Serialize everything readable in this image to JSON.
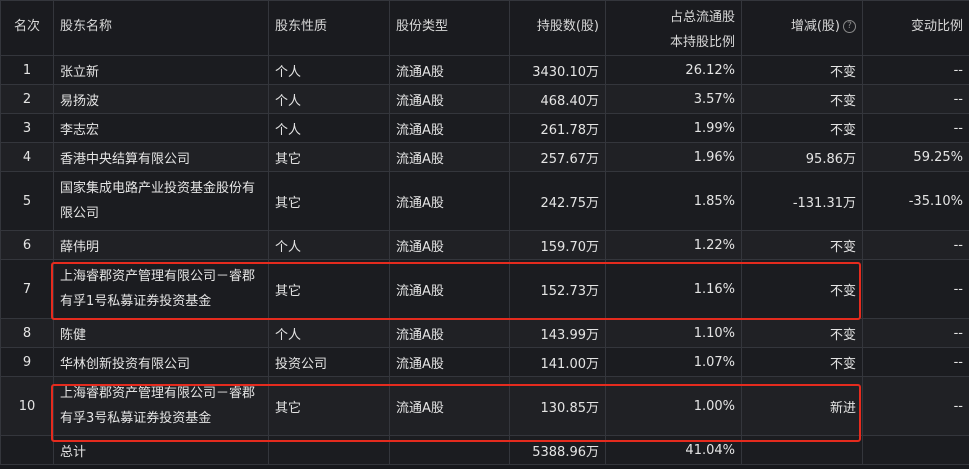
{
  "headers": {
    "rank": "名次",
    "name": "股东名称",
    "nature": "股东性质",
    "share_type": "股份类型",
    "shares": "持股数(股)",
    "ratio_line1": "占总流通股",
    "ratio_line2": "本持股比例",
    "change": "增减(股)",
    "change_help_icon": "?",
    "change_ratio": "变动比例"
  },
  "rows": [
    {
      "rank": "1",
      "name": "张立新",
      "nature": "个人",
      "type": "流通A股",
      "shares": "3430.10万",
      "ratio": "26.12%",
      "change": "不变",
      "change_ratio": "--"
    },
    {
      "rank": "2",
      "name": "易扬波",
      "nature": "个人",
      "type": "流通A股",
      "shares": "468.40万",
      "ratio": "3.57%",
      "change": "不变",
      "change_ratio": "--"
    },
    {
      "rank": "3",
      "name": "李志宏",
      "nature": "个人",
      "type": "流通A股",
      "shares": "261.78万",
      "ratio": "1.99%",
      "change": "不变",
      "change_ratio": "--"
    },
    {
      "rank": "4",
      "name": "香港中央结算有限公司",
      "nature": "其它",
      "type": "流通A股",
      "shares": "257.67万",
      "ratio": "1.96%",
      "change": "95.86万",
      "change_ratio": "59.25%"
    },
    {
      "rank": "5",
      "name": "国家集成电路产业投资基金股份有限公司",
      "nature": "其它",
      "type": "流通A股",
      "shares": "242.75万",
      "ratio": "1.85%",
      "change": "-131.31万",
      "change_ratio": "-35.10%"
    },
    {
      "rank": "6",
      "name": "薛伟明",
      "nature": "个人",
      "type": "流通A股",
      "shares": "159.70万",
      "ratio": "1.22%",
      "change": "不变",
      "change_ratio": "--"
    },
    {
      "rank": "7",
      "name": "上海睿郡资产管理有限公司－睿郡有孚1号私募证券投资基金",
      "nature": "其它",
      "type": "流通A股",
      "shares": "152.73万",
      "ratio": "1.16%",
      "change": "不变",
      "change_ratio": "--"
    },
    {
      "rank": "8",
      "name": "陈健",
      "nature": "个人",
      "type": "流通A股",
      "shares": "143.99万",
      "ratio": "1.10%",
      "change": "不变",
      "change_ratio": "--"
    },
    {
      "rank": "9",
      "name": "华林创新投资有限公司",
      "nature": "投资公司",
      "type": "流通A股",
      "shares": "141.00万",
      "ratio": "1.07%",
      "change": "不变",
      "change_ratio": "--"
    },
    {
      "rank": "10",
      "name": "上海睿郡资产管理有限公司－睿郡有孚3号私募证券投资基金",
      "nature": "其它",
      "type": "流通A股",
      "shares": "130.85万",
      "ratio": "1.00%",
      "change": "新进",
      "change_ratio": "--"
    }
  ],
  "total": {
    "label": "总计",
    "shares": "5388.96万",
    "ratio": "41.04%"
  },
  "highlight_color": "#e52b1e"
}
